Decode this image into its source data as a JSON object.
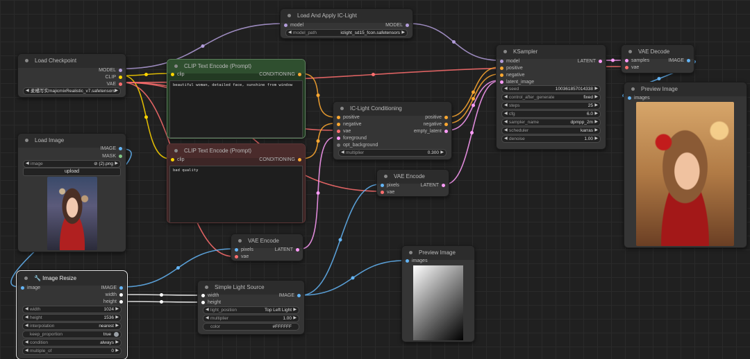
{
  "colors": {
    "model": "#b39ddb",
    "clip": "#ffd500",
    "vae": "#ff6e6e",
    "conditioning": "#ffa931",
    "latent": "#ff9cf9",
    "image": "#64b5f6",
    "int": "#ffffff",
    "mask": "#81c784"
  },
  "nodes": {
    "load_checkpoint": {
      "title": "Load Checkpoint",
      "outputs": [
        "MODEL",
        "CLIP",
        "VAE"
      ],
      "ckpt_value": "麦橘写实majicmixRealistic_v7.safetensors"
    },
    "load_ic_light": {
      "title": "Load And Apply IC-Light",
      "input": "model",
      "output": "MODEL",
      "widget_label": "model_path",
      "widget_value": "iclight_sd15_fcon.safetensors"
    },
    "clip_pos": {
      "title": "CLIP Text Encode (Prompt)",
      "input": "clip",
      "output": "CONDITIONING",
      "text": "beautiful woman, detailed face, sunshine from window"
    },
    "clip_neg": {
      "title": "CLIP Text Encode (Prompt)",
      "input": "clip",
      "output": "CONDITIONING",
      "text": "bad quality"
    },
    "ic_cond": {
      "title": "IC-Light Conditioning",
      "inputs": [
        "positive",
        "negative",
        "vae",
        "foreground",
        "opt_background"
      ],
      "outputs": [
        "positive",
        "negative",
        "empty_latent"
      ],
      "widget_label": "multiplier",
      "widget_value": "0.300"
    },
    "ksampler": {
      "title": "KSampler",
      "inputs": [
        "model",
        "positive",
        "negative",
        "latent_image"
      ],
      "output": "LATENT",
      "widgets": [
        {
          "label": "seed",
          "value": "100361857014338"
        },
        {
          "label": "control_after_generate",
          "value": "fixed"
        },
        {
          "label": "steps",
          "value": "25"
        },
        {
          "label": "cfg",
          "value": "6.0"
        },
        {
          "label": "sampler_name",
          "value": "dpmpp_2m"
        },
        {
          "label": "scheduler",
          "value": "karras"
        },
        {
          "label": "denoise",
          "value": "1.00"
        }
      ]
    },
    "vae_decode": {
      "title": "VAE Decode",
      "inputs": [
        "samples",
        "vae"
      ],
      "output": "IMAGE"
    },
    "preview_right": {
      "title": "Preview Image",
      "input": "images"
    },
    "load_image": {
      "title": "Load Image",
      "outputs": [
        "IMAGE",
        "MASK"
      ],
      "widget_label": "image",
      "widget_value": "⊘ (2).png",
      "upload_label": "upload"
    },
    "vae_encode_1": {
      "title": "VAE Encode",
      "inputs": [
        "pixels",
        "vae"
      ],
      "output": "LATENT"
    },
    "vae_encode_2": {
      "title": "VAE Encode",
      "inputs": [
        "pixels",
        "vae"
      ],
      "output": "LATENT"
    },
    "preview_mid": {
      "title": "Preview Image",
      "input": "images"
    },
    "image_resize": {
      "title": "🔧 Image Resize",
      "input": "image",
      "outputs": [
        "IMAGE",
        "width",
        "height"
      ],
      "widgets": [
        {
          "label": "width",
          "value": "1024"
        },
        {
          "label": "height",
          "value": "1536"
        },
        {
          "label": "interpolation",
          "value": "nearest"
        },
        {
          "label": "keep_proportion",
          "value": "true"
        },
        {
          "label": "condition",
          "value": "always"
        },
        {
          "label": "multiple_of",
          "value": "0"
        }
      ]
    },
    "light_source": {
      "title": "Simple Light Source",
      "inputs": [
        "width",
        "height"
      ],
      "output": "IMAGE",
      "widgets": [
        {
          "label": "light_position",
          "value": "Top Left Light"
        },
        {
          "label": "multiplier",
          "value": "1.00"
        },
        {
          "label": "color",
          "value": "#FFFFFF"
        }
      ]
    }
  }
}
